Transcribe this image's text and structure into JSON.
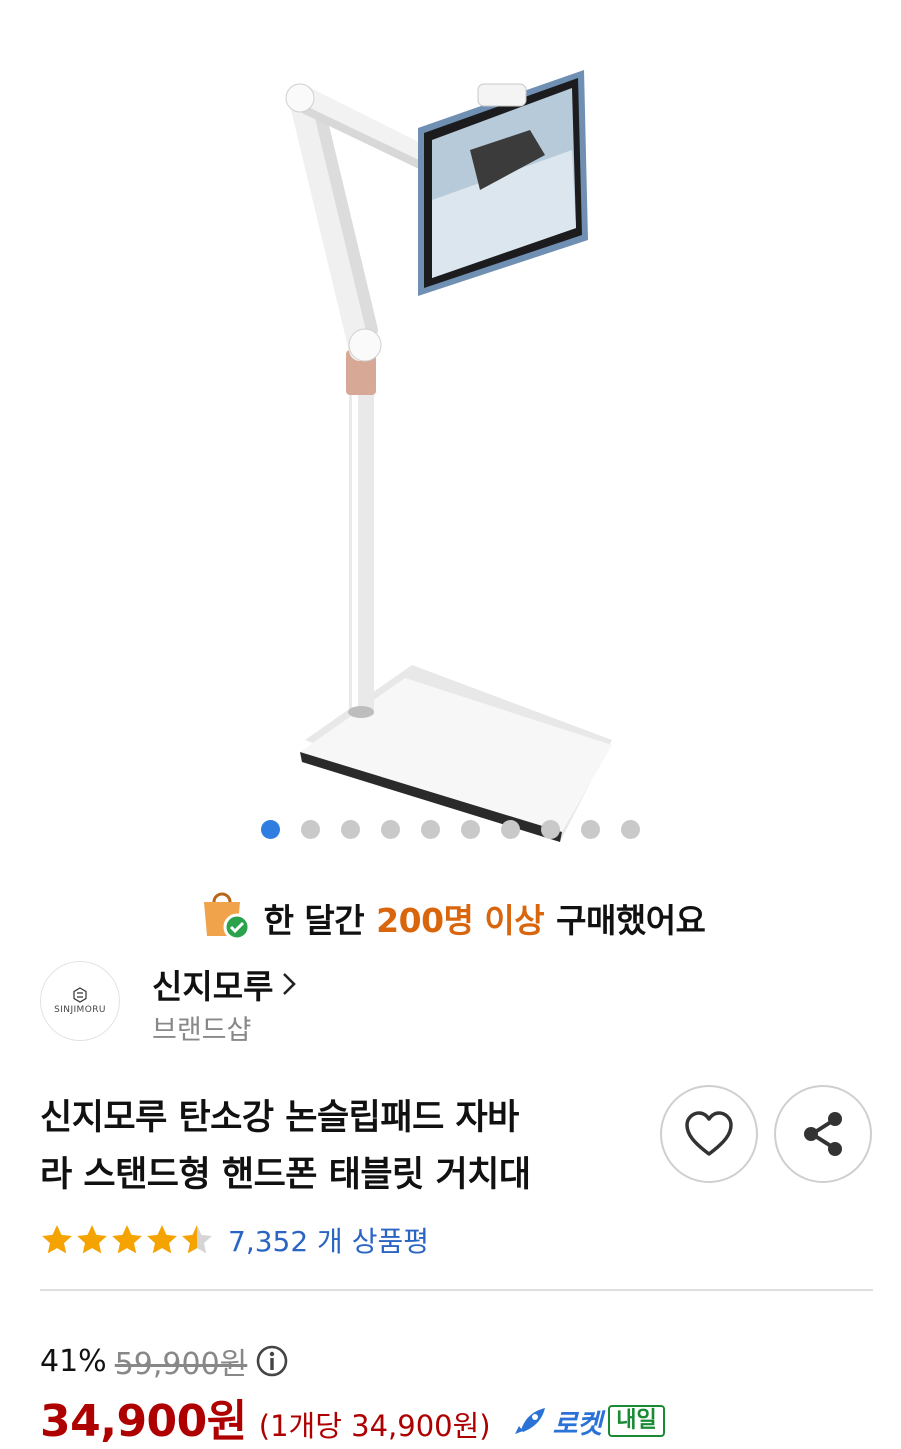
{
  "carousel": {
    "total": 10,
    "active": 0
  },
  "proof": {
    "prefix": "한 달간",
    "highlight": "200명 이상",
    "suffix": "구매했어요"
  },
  "brand": {
    "logo_text": "SINJIMORU",
    "name": "신지모루",
    "sub": "브랜드샵"
  },
  "product": {
    "title_line1": "신지모루 탄소강 논슬립패드 자바",
    "title_line2": "라 스탠드형 핸드폰 태블릿 거치대",
    "rating": 4.5,
    "review_count": "7,352 개 상품평"
  },
  "price": {
    "discount": "41%",
    "original": "59,900원",
    "current": "34,900원",
    "unit": "(1개당 34,900원)",
    "rocket": "로켓",
    "delivery_badge": "내일"
  },
  "colors": {
    "accent": "#2f7de1",
    "price": "#ae0000",
    "highlight": "#d9660d",
    "star": "#f5a300",
    "rocket": "#2b72d6",
    "tomorrow": "#1b8a34"
  }
}
